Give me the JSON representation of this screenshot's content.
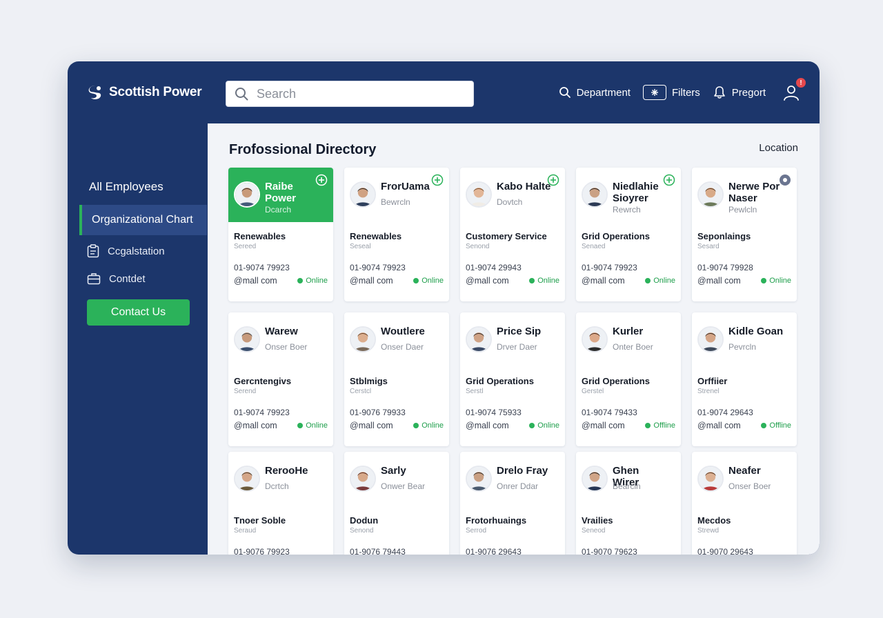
{
  "brand": {
    "name": "Scottish Power"
  },
  "search": {
    "placeholder": "Search"
  },
  "nav": {
    "department": "Department",
    "filters": "Filters",
    "report": "Pregort",
    "notification_badge": "!"
  },
  "sidebar": {
    "all_employees": "All Employees",
    "org_chart": "Organizational Chart",
    "sub_items": [
      "Ccgalstation",
      "Contdet"
    ],
    "contact_us": "Contact Us"
  },
  "main": {
    "title": "Frofossional Directory",
    "location_label": "Location"
  },
  "colors": {
    "navy": "#1c366b",
    "green": "#2bb25a",
    "badge": "#e5484d"
  },
  "cards": [
    {
      "name": "Raibe Power",
      "role": "Dcarch",
      "dept": "Renewables",
      "sub": "Sereed",
      "phone": "01-9074 79923",
      "email": "@mall com",
      "status": "Online",
      "highlight": true,
      "icon": "plus",
      "skin": "#c89a7a",
      "hair": "#3b2a20",
      "shirt": "#445a7a"
    },
    {
      "name": "FrorUama",
      "role": "Bewrcln",
      "dept": "Renewables",
      "sub": "Seseal",
      "phone": "01-9074 79923",
      "email": "@mall com",
      "status": "Online",
      "highlight": false,
      "icon": "plus",
      "skin": "#d0a283",
      "hair": "#2d231d",
      "shirt": "#2e3f5c"
    },
    {
      "name": "Kabo Halte",
      "role": "Dovtch",
      "dept": "Customery Service",
      "sub": "Senond",
      "phone": "01-9074 29943",
      "email": "@mall com",
      "status": "Online",
      "highlight": false,
      "icon": "plus",
      "skin": "#e2b697",
      "hair": "#7a4e2e",
      "shirt": "#f0ece6"
    },
    {
      "name": "Niedlahie Sioyrer",
      "role": "Rewrch",
      "dept": "Grid Operations",
      "sub": "Senaed",
      "phone": "01-9074 79923",
      "email": "@mall com",
      "status": "Online",
      "highlight": false,
      "icon": "plus",
      "skin": "#caa184",
      "hair": "#2a211c",
      "shirt": "#2c3a55"
    },
    {
      "name": "Nerwe Por Naser",
      "role": "Pewlcln",
      "dept": "Seponlaings",
      "sub": "Sesard",
      "phone": "01-9074 79928",
      "email": "@mall com",
      "status": "Online",
      "highlight": false,
      "icon": "gear",
      "skin": "#d8aa88",
      "hair": "#5a3b24",
      "shirt": "#6c7a5a"
    },
    {
      "name": "Warew",
      "role": "Onser Boer",
      "dept": "Gercntengivs",
      "sub": "Serend",
      "phone": "01-9074 79923",
      "email": "@mall com",
      "status": "Online",
      "highlight": false,
      "icon": "",
      "skin": "#c79a7c",
      "hair": "#4a4a4a",
      "shirt": "#3b4f6e"
    },
    {
      "name": "Woutlere",
      "role": "Onser Daer",
      "dept": "Stblmigs",
      "sub": "Cerstcl",
      "phone": "01-9076 79933",
      "email": "@mall com",
      "status": "Online",
      "highlight": false,
      "icon": "",
      "skin": "#dcae8e",
      "hair": "#6b4428",
      "shirt": "#7a6a5a"
    },
    {
      "name": "Price Sip",
      "role": "Drver Daer",
      "dept": "Grid Operations",
      "sub": "Serstl",
      "phone": "01-9074 75933",
      "email": "@mall com",
      "status": "Online",
      "highlight": false,
      "icon": "",
      "skin": "#cfa386",
      "hair": "#3a2d25",
      "shirt": "#3a4a66"
    },
    {
      "name": "Kurler",
      "role": "Onter Boer",
      "dept": "Grid Operations",
      "sub": "Gerstel",
      "phone": "01-9074 79433",
      "email": "@mall com",
      "status": "Offline",
      "highlight": false,
      "icon": "",
      "skin": "#dca98a",
      "hair": "#4a2c1c",
      "shirt": "#2c2c2c"
    },
    {
      "name": "Kidle Goan",
      "role": "Pevrcln",
      "dept": "Orffiier",
      "sub": "Strenel",
      "phone": "01-9074 29643",
      "email": "@mall com",
      "status": "Offline",
      "highlight": false,
      "icon": "",
      "skin": "#d4a587",
      "hair": "#3a2a20",
      "shirt": "#3e4a5c"
    },
    {
      "name": "RerooHe",
      "role": "Dcrtch",
      "dept": "Tnoer Soble",
      "sub": "Seraud",
      "phone": "01-9076 79923",
      "email": "",
      "status": "",
      "highlight": false,
      "icon": "",
      "skin": "#d4a688",
      "hair": "#4a3a2a",
      "shirt": "#6b5a3a"
    },
    {
      "name": "Sarly",
      "role": "Onwer Bear",
      "dept": "Dodun",
      "sub": "Senond",
      "phone": "01-9076 79443",
      "email": "",
      "status": "",
      "highlight": false,
      "icon": "",
      "skin": "#d7a98a",
      "hair": "#5a2c20",
      "shirt": "#7a3a3a"
    },
    {
      "name": "Drelo Fray",
      "role": "Onrer Ddar",
      "dept": "Frotorhuaings",
      "sub": "Serrod",
      "phone": "01-9076 29643",
      "email": "",
      "status": "",
      "highlight": false,
      "icon": "",
      "skin": "#c9a083",
      "hair": "#3a3028",
      "shirt": "#4a5a6e"
    },
    {
      "name": "Ghen Wirer",
      "role": "Bearcln",
      "dept": "Vrailies",
      "sub": "Seneod",
      "phone": "01-9070 79623",
      "email": "",
      "status": "",
      "highlight": false,
      "icon": "",
      "skin": "#d0a487",
      "hair": "#2a2420",
      "shirt": "#243554"
    },
    {
      "name": "Neafer",
      "role": "Onser Boer",
      "dept": "Mecdos",
      "sub": "Strewd",
      "phone": "01-9070 29643",
      "email": "",
      "status": "",
      "highlight": false,
      "icon": "",
      "skin": "#dcb092",
      "hair": "#5a3a24",
      "shirt": "#b83a3a"
    }
  ]
}
